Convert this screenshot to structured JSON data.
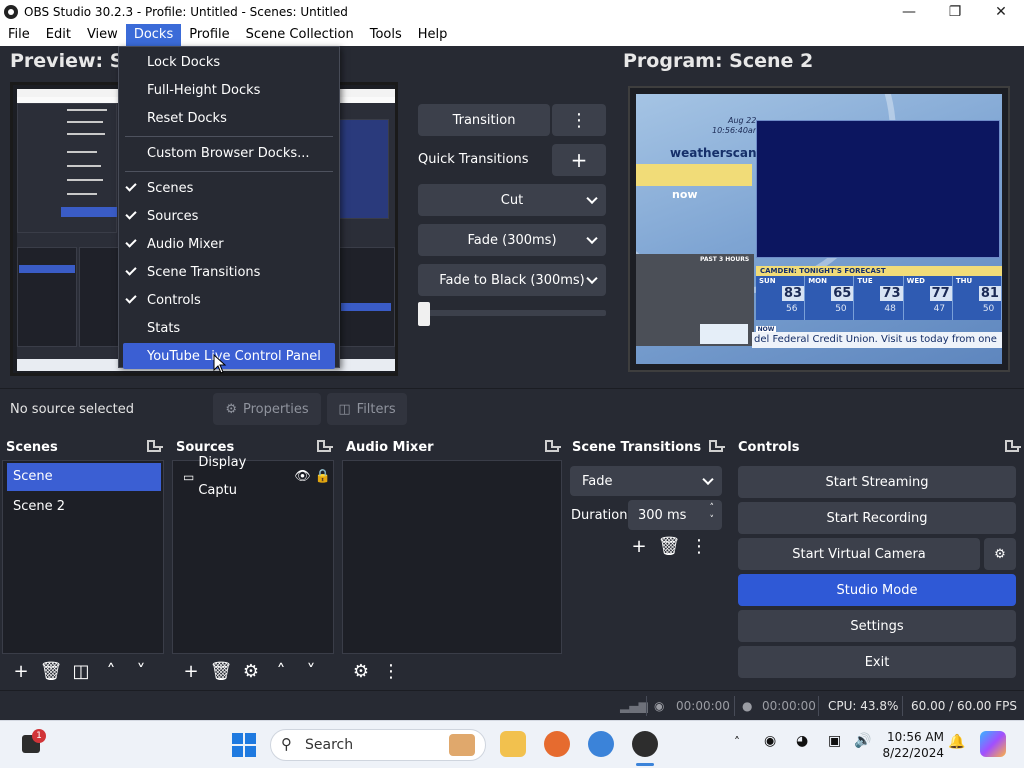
{
  "window": {
    "title": "OBS Studio 30.2.3 - Profile: Untitled - Scenes: Untitled",
    "min_icon": "minimize-icon",
    "max_icon": "maximize-icon",
    "close_icon": "close-icon"
  },
  "menubar": [
    "File",
    "Edit",
    "View",
    "Docks",
    "Profile",
    "Scene Collection",
    "Tools",
    "Help"
  ],
  "docks_menu": {
    "items": [
      {
        "label": "Lock Docks",
        "checked": false
      },
      {
        "label": "Full-Height Docks",
        "checked": false
      },
      {
        "label": "Reset Docks",
        "checked": false
      },
      {
        "label": "Custom Browser Docks...",
        "checked": false
      },
      {
        "label": "Scenes",
        "checked": true
      },
      {
        "label": "Sources",
        "checked": true
      },
      {
        "label": "Audio Mixer",
        "checked": true
      },
      {
        "label": "Scene Transitions",
        "checked": true
      },
      {
        "label": "Controls",
        "checked": true
      },
      {
        "label": "Stats",
        "checked": false
      },
      {
        "label": "YouTube Live Control Panel",
        "checked": false,
        "highlighted": true
      }
    ]
  },
  "preview": {
    "title": "Preview: Sc"
  },
  "program": {
    "title": "Program: Scene 2",
    "weather": {
      "date": "Aug 22",
      "time": "10:56:40am",
      "brand": "weatherscan",
      "now": "now",
      "past": "PAST 3 HOURS",
      "forecast_header": "CAMDEN:   TONIGHT'S FORECAST",
      "days": [
        {
          "day": "SUN",
          "hi": "83",
          "lo": "56"
        },
        {
          "day": "MON",
          "hi": "65",
          "lo": "50"
        },
        {
          "day": "TUE",
          "hi": "73",
          "lo": "48"
        },
        {
          "day": "WED",
          "hi": "77",
          "lo": "47"
        },
        {
          "day": "THU",
          "hi": "81",
          "lo": "50"
        }
      ],
      "now_tag": "NOW",
      "ticker": "del Federal Credit Union. Visit us today from one"
    }
  },
  "transitions_panel": {
    "transition": "Transition",
    "quick": "Quick Transitions",
    "options": [
      "Cut",
      "Fade (300ms)",
      "Fade to Black (300ms)"
    ]
  },
  "source_bar": {
    "no_source": "No source selected",
    "properties": "Properties",
    "filters": "Filters"
  },
  "docks": {
    "scenes": {
      "title": "Scenes",
      "items": [
        "Scene",
        "Scene 2"
      ]
    },
    "sources": {
      "title": "Sources",
      "items": [
        "Display Captu"
      ]
    },
    "mixer": {
      "title": "Audio Mixer"
    },
    "scene_transitions": {
      "title": "Scene Transitions",
      "selected": "Fade",
      "duration_label": "Duration",
      "duration_value": "300 ms"
    },
    "controls": {
      "title": "Controls",
      "buttons": [
        "Start Streaming",
        "Start Recording",
        "Start Virtual Camera",
        "Studio Mode",
        "Settings",
        "Exit"
      ]
    }
  },
  "status": {
    "stream_time": "00:00:00",
    "rec_time": "00:00:00",
    "cpu": "CPU: 43.8%",
    "fps": "60.00 / 60.00 FPS"
  },
  "taskbar": {
    "search": "Search",
    "time": "10:56 AM",
    "date": "8/22/2024",
    "notif_count": "1"
  },
  "colors": {
    "accent": "#3b5fd3",
    "bg": "#272a33"
  }
}
